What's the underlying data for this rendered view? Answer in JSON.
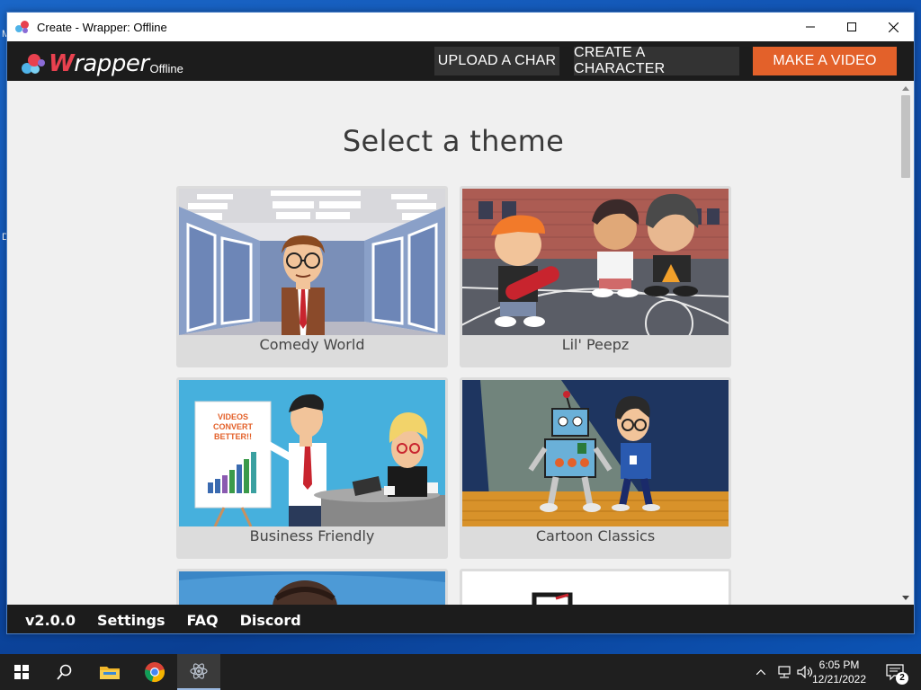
{
  "window": {
    "title": "Create - Wrapper: Offline"
  },
  "header": {
    "logo_text_w": "W",
    "logo_text_rest": "rapper",
    "logo_sub": "Offline",
    "buttons": {
      "upload_char": "UPLOAD A CHAR",
      "create_character": "CREATE A CHARACTER",
      "make_video": "MAKE A VIDEO"
    }
  },
  "main": {
    "title": "Select a theme",
    "themes": [
      {
        "label": "Comedy World"
      },
      {
        "label": "Lil' Peepz"
      },
      {
        "label": "Business Friendly"
      },
      {
        "label": "Cartoon Classics"
      }
    ],
    "business_sign": "VIDEOS CONVERT BETTER!!"
  },
  "footer": {
    "version": "v2.0.0",
    "settings": "Settings",
    "faq": "FAQ",
    "discord": "Discord"
  },
  "desktop": {
    "edge_letter_1": "M",
    "edge_letter_2": "D"
  },
  "taskbar": {
    "time": "6:05 PM",
    "date": "12/21/2022",
    "notification_count": "2"
  },
  "colors": {
    "accent": "#e3612a",
    "header_bg": "#1c1c1c",
    "header_button_bg": "#333333"
  }
}
